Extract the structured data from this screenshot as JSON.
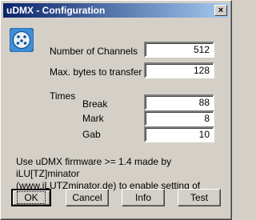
{
  "window": {
    "title": "uDMX - Configuration",
    "close_glyph": "×"
  },
  "icons": {
    "app": "dmx-connector-icon"
  },
  "fields": {
    "channels": {
      "label": "Number of Channels",
      "value": "512"
    },
    "max_bytes": {
      "label": "Max. bytes to transfer",
      "value": "128"
    }
  },
  "times": {
    "header": "Times",
    "break": {
      "label": "Break",
      "value": "88"
    },
    "mark": {
      "label": "Mark",
      "value": "8"
    },
    "gab": {
      "label": "Gab",
      "value": "10"
    }
  },
  "info": {
    "line1": "Use uDMX firmware >= 1.4 made by iLU[TZ]minator",
    "line2": "(www.iLUTZminator.de) to enable setting of times"
  },
  "buttons": {
    "ok": "OK",
    "cancel": "Cancel",
    "info": "Info",
    "test": "Test"
  },
  "colors": {
    "titlebar_start": "#0a246a",
    "titlebar_end": "#a6caf0",
    "face": "#d4d0c8"
  }
}
